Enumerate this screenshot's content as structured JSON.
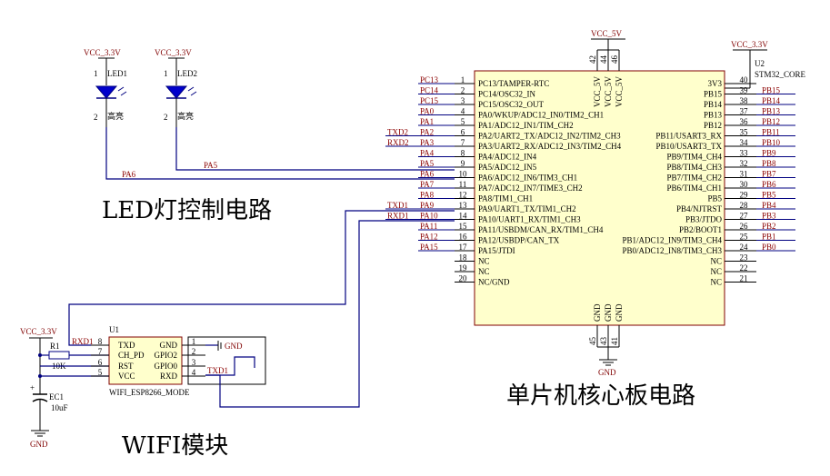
{
  "titles": {
    "led": "LED灯控制电路",
    "mcu": "单片机核心板电路",
    "wifi": "WIFI模块"
  },
  "power": {
    "vcc33": "VCC_3.3V",
    "vcc5": "VCC_5V",
    "gnd": "GND"
  },
  "leds": [
    {
      "ref": "LED1",
      "value": "高亮",
      "net": "PA6",
      "pin1": "1",
      "pin2": "2"
    },
    {
      "ref": "LED2",
      "value": "高亮",
      "net": "PA5",
      "pin1": "1",
      "pin2": "2"
    }
  ],
  "mcu": {
    "designator": "U2",
    "part": "STM32_CORE",
    "left_pins": [
      {
        "num": "1",
        "name": "PC13/TAMPER-RTC",
        "net": "PC13"
      },
      {
        "num": "2",
        "name": "PC14/OSC32_IN",
        "net": "PC14"
      },
      {
        "num": "3",
        "name": "PC15/OSC32_OUT",
        "net": "PC15"
      },
      {
        "num": "4",
        "name": "PA0/WKUP/ADC12_IN0/TIM2_CH1",
        "net": "PA0"
      },
      {
        "num": "5",
        "name": "PA1/ADC12_IN1/TIM_CH2",
        "net": "PA1"
      },
      {
        "num": "6",
        "name": "PA2/UART2_TX/ADC12_IN2/TIM2_CH3",
        "net": "PA2",
        "net2": "TXD2"
      },
      {
        "num": "7",
        "name": "PA3/UART2_RX/ADC12_IN3/TIM2_CH4",
        "net": "PA3",
        "net2": "RXD2"
      },
      {
        "num": "8",
        "name": "PA4/ADC12_IN4",
        "net": "PA4"
      },
      {
        "num": "9",
        "name": "PA5/ADC12_IN5",
        "net": "PA5"
      },
      {
        "num": "10",
        "name": "PA6/ADC12_IN6/TIM3_CH1",
        "net": "PA6"
      },
      {
        "num": "11",
        "name": "PA7/ADC12_IN7/TIME3_CH2",
        "net": "PA7"
      },
      {
        "num": "12",
        "name": "PA8/TIM1_CH1",
        "net": "PA8"
      },
      {
        "num": "13",
        "name": "PA9/UART1_TX/TIM1_CH2",
        "net": "PA9",
        "net2": "TXD1"
      },
      {
        "num": "14",
        "name": "PA10/UART1_RX/TIM1_CH3",
        "net": "PA10",
        "net2": "RXD1"
      },
      {
        "num": "15",
        "name": "PA11/USBDM/CAN_RX/TIM1_CH4",
        "net": "PA11"
      },
      {
        "num": "16",
        "name": "PA12/USBDP/CAN_TX",
        "net": "PA12"
      },
      {
        "num": "17",
        "name": "PA15/JTDI",
        "net": "PA15"
      },
      {
        "num": "18",
        "name": "NC",
        "net": ""
      },
      {
        "num": "19",
        "name": "NC",
        "net": ""
      },
      {
        "num": "20",
        "name": "NC/GND",
        "net": ""
      }
    ],
    "right_pins": [
      {
        "num": "40",
        "name": "3V3",
        "net": ""
      },
      {
        "num": "39",
        "name": "PB15",
        "net": "PB15"
      },
      {
        "num": "38",
        "name": "PB14",
        "net": "PB14"
      },
      {
        "num": "37",
        "name": "PB13",
        "net": "PB13"
      },
      {
        "num": "36",
        "name": "PB12",
        "net": "PB12"
      },
      {
        "num": "35",
        "name": "PB11/USART3_RX",
        "net": "PB11"
      },
      {
        "num": "34",
        "name": "PB10/USART3_TX",
        "net": "PB10"
      },
      {
        "num": "33",
        "name": "PB9/TIM4_CH4",
        "net": "PB9"
      },
      {
        "num": "32",
        "name": "PB8/TIM4_CH3",
        "net": "PB8"
      },
      {
        "num": "31",
        "name": "PB7/TIM4_CH2",
        "net": "PB7"
      },
      {
        "num": "30",
        "name": "PB6/TIM4_CH1",
        "net": "PB6"
      },
      {
        "num": "29",
        "name": "PB5",
        "net": "PB5"
      },
      {
        "num": "28",
        "name": "PB4/NJTRST",
        "net": "PB4"
      },
      {
        "num": "27",
        "name": "PB3/JTDO",
        "net": "PB3"
      },
      {
        "num": "26",
        "name": "PB2/BOOT1",
        "net": "PB2"
      },
      {
        "num": "25",
        "name": "PB1/ADC12_IN9/TIM3_CH4",
        "net": "PB1"
      },
      {
        "num": "24",
        "name": "PB0/ADC12_IN8/TIM3_CH3",
        "net": "PB0"
      },
      {
        "num": "23",
        "name": "NC",
        "net": ""
      },
      {
        "num": "22",
        "name": "NC",
        "net": ""
      },
      {
        "num": "21",
        "name": "NC",
        "net": ""
      }
    ],
    "top_pins": [
      {
        "num": "42",
        "name": "VCC_5V"
      },
      {
        "num": "44",
        "name": "VCC_5V"
      },
      {
        "num": "46",
        "name": "VCC_5V"
      }
    ],
    "bottom_pins": [
      {
        "num": "45",
        "name": "GND"
      },
      {
        "num": "43",
        "name": "GND"
      },
      {
        "num": "41",
        "name": "GND"
      }
    ]
  },
  "wifi": {
    "designator": "U1",
    "part": "WIFI_ESP8266_MODE",
    "left_pins": [
      {
        "num": "8",
        "name": "TXD"
      },
      {
        "num": "7",
        "name": "CH_PD"
      },
      {
        "num": "6",
        "name": "RST"
      },
      {
        "num": "5",
        "name": "VCC"
      }
    ],
    "right_pins": [
      {
        "num": "1",
        "name": "GND"
      },
      {
        "num": "2",
        "name": "GPIO2"
      },
      {
        "num": "3",
        "name": "GPIO0"
      },
      {
        "num": "4",
        "name": "RXD"
      }
    ],
    "net_rxd1": "RXD1",
    "net_txd1": "TXD1",
    "gnd_label": "GND"
  },
  "resistor": {
    "ref": "R1",
    "value": "10K"
  },
  "capacitor": {
    "ref": "EC1",
    "value": "10uF"
  },
  "colors": {
    "wire": "#000080",
    "net_label": "#8b0000",
    "body_fill": "#ffffcc",
    "body_stroke": "#800000"
  }
}
